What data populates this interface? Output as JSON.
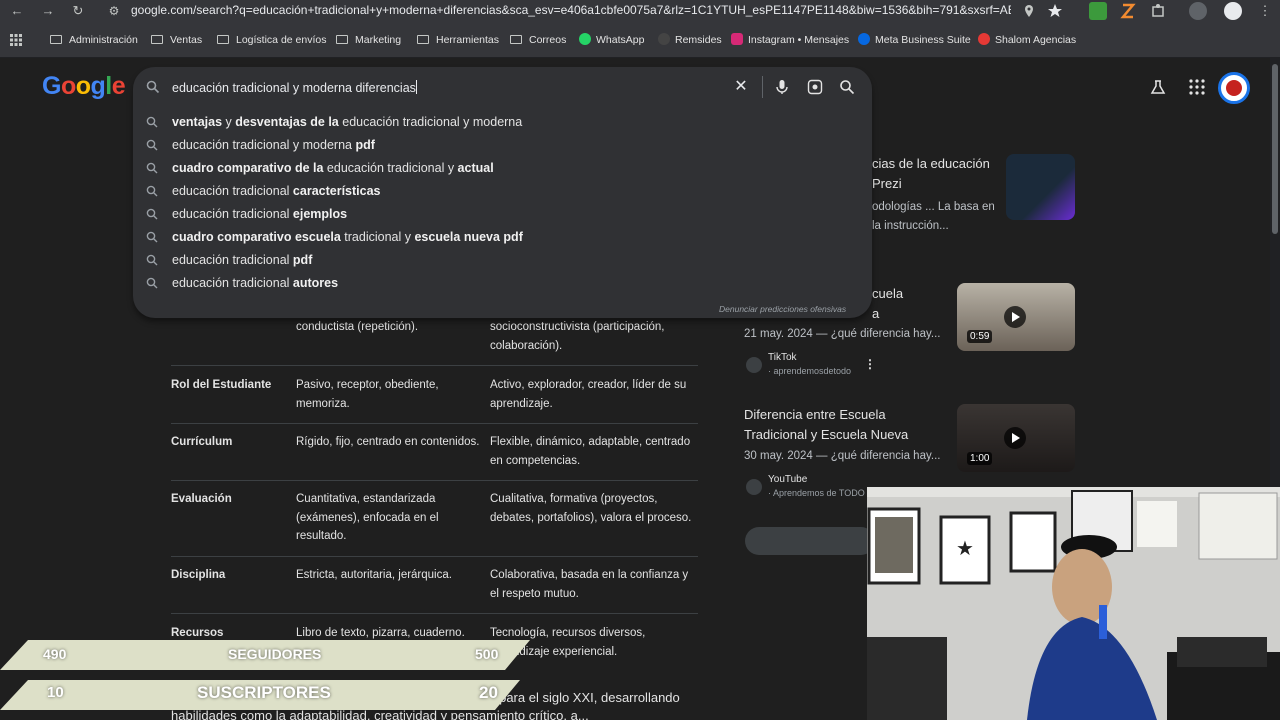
{
  "browser": {
    "url": "google.com/search?q=educación+tradicional+y+moderna+diferencias&sca_esv=e406a1cbfe0075a7&rlz=1C1YTUH_esPE1147PE1148&biw=1536&bih=791&sxsrf=AE3Ti...",
    "bookmarks": [
      {
        "label": "Administración",
        "icon": "folder-icon"
      },
      {
        "label": "Ventas",
        "icon": "folder-icon"
      },
      {
        "label": "Logística de envíos",
        "icon": "folder-icon"
      },
      {
        "label": "Marketing",
        "icon": "folder-icon"
      },
      {
        "label": "Herramientas",
        "icon": "folder-icon"
      },
      {
        "label": "Correos",
        "icon": "folder-icon"
      },
      {
        "label": "WhatsApp",
        "icon": "whatsapp-icon"
      },
      {
        "label": "Remsides",
        "icon": "remsides-icon"
      },
      {
        "label": "Instagram • Mensajes",
        "icon": "instagram-icon"
      },
      {
        "label": "Meta Business Suite",
        "icon": "meta-icon"
      },
      {
        "label": "Shalom Agencias",
        "icon": "shalom-icon"
      }
    ]
  },
  "search": {
    "query": "educación tradicional y moderna diferencias",
    "suggestions": [
      {
        "pre": "ventajas",
        "mid1": " y ",
        "bold2": "desventajas de la",
        "rest": " educación tradicional y moderna",
        "post": ""
      },
      {
        "pre": "",
        "mid1": "educación tradicional y moderna ",
        "bold2": "pdf",
        "rest": "",
        "post": ""
      },
      {
        "pre": "cuadro comparativo de la",
        "mid1": " educación tradicional y ",
        "bold2": "actual",
        "rest": "",
        "post": ""
      },
      {
        "pre": "",
        "mid1": "educación tradicional ",
        "bold2": "características",
        "rest": "",
        "post": ""
      },
      {
        "pre": "",
        "mid1": "educación tradicional ",
        "bold2": "ejemplos",
        "rest": "",
        "post": ""
      },
      {
        "pre": "cuadro comparativo escuela",
        "mid1": " tradicional y ",
        "bold2": "escuela nueva pdf",
        "rest": "",
        "post": ""
      },
      {
        "pre": "",
        "mid1": "educación tradicional ",
        "bold2": "pdf",
        "rest": "",
        "post": ""
      },
      {
        "pre": "",
        "mid1": "educación tradicional ",
        "bold2": "autores",
        "rest": "",
        "post": ""
      }
    ],
    "report_label": "Denunciar predicciones ofensivas"
  },
  "table": {
    "partial_row": {
      "c2": "conductista (repetición).",
      "c3": "socioconstructivista (participación, colaboración)."
    },
    "rows": [
      {
        "label": "Rol del Estudiante",
        "tradicional": "Pasivo, receptor, obediente, memoriza.",
        "moderna": "Activo, explorador, creador, líder de su aprendizaje."
      },
      {
        "label": "Currículum",
        "tradicional": "Rígido, fijo, centrado en contenidos.",
        "moderna": "Flexible, dinámico, adaptable, centrado en competencias."
      },
      {
        "label": "Evaluación",
        "tradicional": "Cuantitativa, estandarizada (exámenes), enfocada en el resultado.",
        "moderna": "Cualitativa, formativa (proyectos, debates, portafolios), valora el proceso."
      },
      {
        "label": "Disciplina",
        "tradicional": "Estricta, autoritaria, jerárquica.",
        "moderna": "Colaborativa, basada en la confianza y el respeto mutuo."
      },
      {
        "label": "Recursos",
        "tradicional": "Libro de texto, pizarra, cuaderno.",
        "moderna": "Tecnología, recursos diversos, aprendizaje experiencial."
      }
    ],
    "paragraph": "La educación moderna busca preparar a los estudiantes para el siglo XXI, desarrollando habilidades como la adaptabilidad, creatividad y pensamiento crítico, a..."
  },
  "right_panel": {
    "prezi_title": "cias de la educación Prezi",
    "prezi_snippet": "odologías ... La basa en la instrucción...",
    "video1": {
      "title_partial": "cuela",
      "title_line2": "a",
      "date": "21 may. 2024 — ¿qué diferencia hay...",
      "source": "TikTok",
      "user": "· aprendemosdetodo",
      "duration": "0:59"
    },
    "video2": {
      "title": "Diferencia entre Escuela Tradicional y Escuela Nueva",
      "date": "30 may. 2024 — ¿qué diferencia hay...",
      "source": "YouTube",
      "user": "· Aprendemos de TODO",
      "duration": "1:00"
    }
  },
  "overlay": {
    "followers_current": "490",
    "followers_label": "SEGUIDORES",
    "followers_goal": "500",
    "subs_current": "10",
    "subs_label": "SUSCRIPTORES",
    "subs_goal": "20"
  }
}
